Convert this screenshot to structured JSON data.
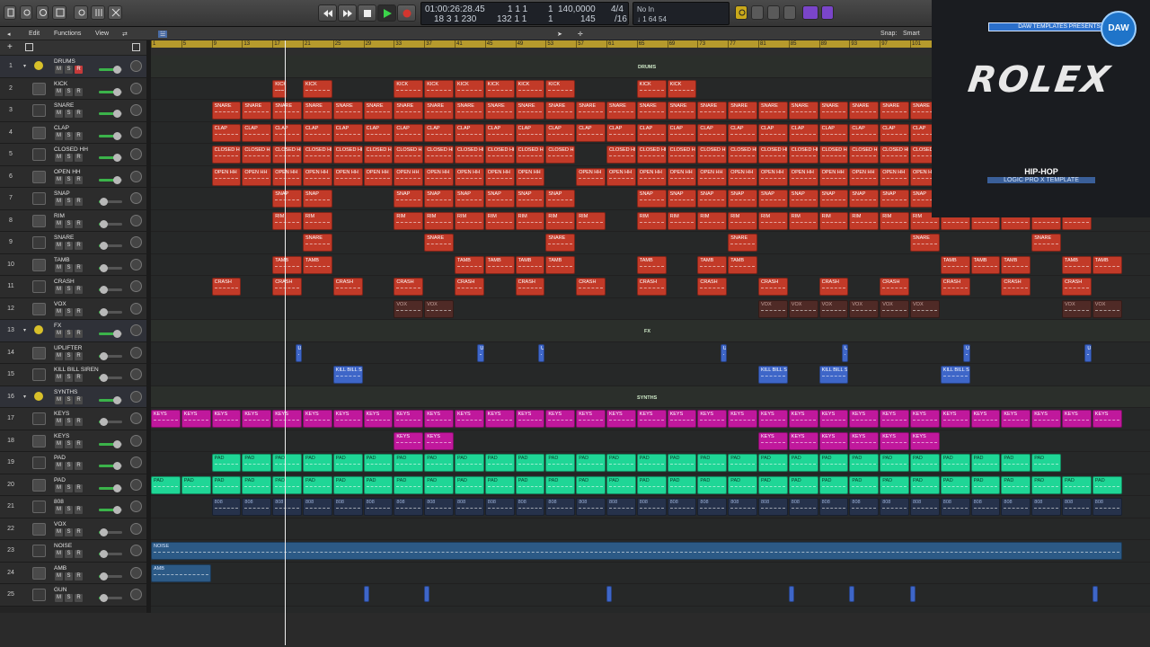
{
  "transport": {
    "timecode": "01:00:26:28.45",
    "bars": "18 3 1 230",
    "pos2_top": "1  1  1",
    "pos2_bot": "132 1 1",
    "pos3_top": "1",
    "pos3_bot": "1",
    "tempo": "140,0000",
    "tempo2": "145",
    "sig_top": "4/4",
    "sig_bot": "/16",
    "in": "No In",
    "out": "↓ 1  64  54"
  },
  "menubar": {
    "edit": "Edit",
    "functions": "Functions",
    "view": "View",
    "snap_label": "Snap:",
    "snap_value": "Smart",
    "flex": "☱"
  },
  "ruler": [
    "1",
    "5",
    "9",
    "13",
    "17",
    "21",
    "25",
    "29",
    "33",
    "37",
    "41",
    "45",
    "49",
    "53",
    "57",
    "61",
    "65",
    "69",
    "73",
    "77",
    "81",
    "85",
    "89",
    "93",
    "97",
    "101"
  ],
  "tracks": [
    {
      "n": "1",
      "name": "DRUMS",
      "folder": true
    },
    {
      "n": "2",
      "name": "KICK"
    },
    {
      "n": "3",
      "name": "SNARE"
    },
    {
      "n": "4",
      "name": "CLAP"
    },
    {
      "n": "5",
      "name": "CLOSED HH"
    },
    {
      "n": "6",
      "name": "OPEN HH"
    },
    {
      "n": "7",
      "name": "SNAP"
    },
    {
      "n": "8",
      "name": "RIM"
    },
    {
      "n": "9",
      "name": "SNARE"
    },
    {
      "n": "10",
      "name": "TAMB"
    },
    {
      "n": "11",
      "name": "CRASH"
    },
    {
      "n": "12",
      "name": "VOX"
    },
    {
      "n": "13",
      "name": "FX",
      "folder": true
    },
    {
      "n": "14",
      "name": "UPLIFTER"
    },
    {
      "n": "15",
      "name": "KILL BILL SIREN"
    },
    {
      "n": "16",
      "name": "SYNTHS",
      "folder": true
    },
    {
      "n": "17",
      "name": "KEYS"
    },
    {
      "n": "18",
      "name": "KEYS"
    },
    {
      "n": "19",
      "name": "PAD"
    },
    {
      "n": "20",
      "name": "PAD"
    },
    {
      "n": "21",
      "name": "808"
    },
    {
      "n": "22",
      "name": "VOX"
    },
    {
      "n": "23",
      "name": "NOISE"
    },
    {
      "n": "24",
      "name": "AMB"
    },
    {
      "n": "25",
      "name": "GUN"
    }
  ],
  "folder_labels": {
    "drums": "DRUMS",
    "fx": "FX",
    "synths": "SYNTHS"
  },
  "region_labels": {
    "kick": "KICK",
    "snare": "SNARE",
    "clap": "CLAP",
    "chh": "CLOSED HH",
    "ohh": "OPEN HH",
    "snap": "SNAP",
    "rim": "RIM",
    "tamb": "TAMB",
    "crash": "CRASH",
    "vox": "VOX",
    "up": "U",
    "siren": "KILL BILL S",
    "keys": "KEYS",
    "pad": "PAD",
    "b808": "808",
    "noise": "NOISE",
    "amb": "AMB"
  },
  "thumbnail": {
    "presents": "DAW TEMPLATES PRESENTS",
    "logo": "ROLEX",
    "line1": "HIP-HOP",
    "line2": "LOGIC PRO X TEMPLATE",
    "badge": "DAW"
  },
  "colors": {
    "region_red": "#c23a28",
    "keys": "#c0189c",
    "pad": "#1fd696",
    "fx": "#3e66c8",
    "cycle": "#b69a2c"
  }
}
